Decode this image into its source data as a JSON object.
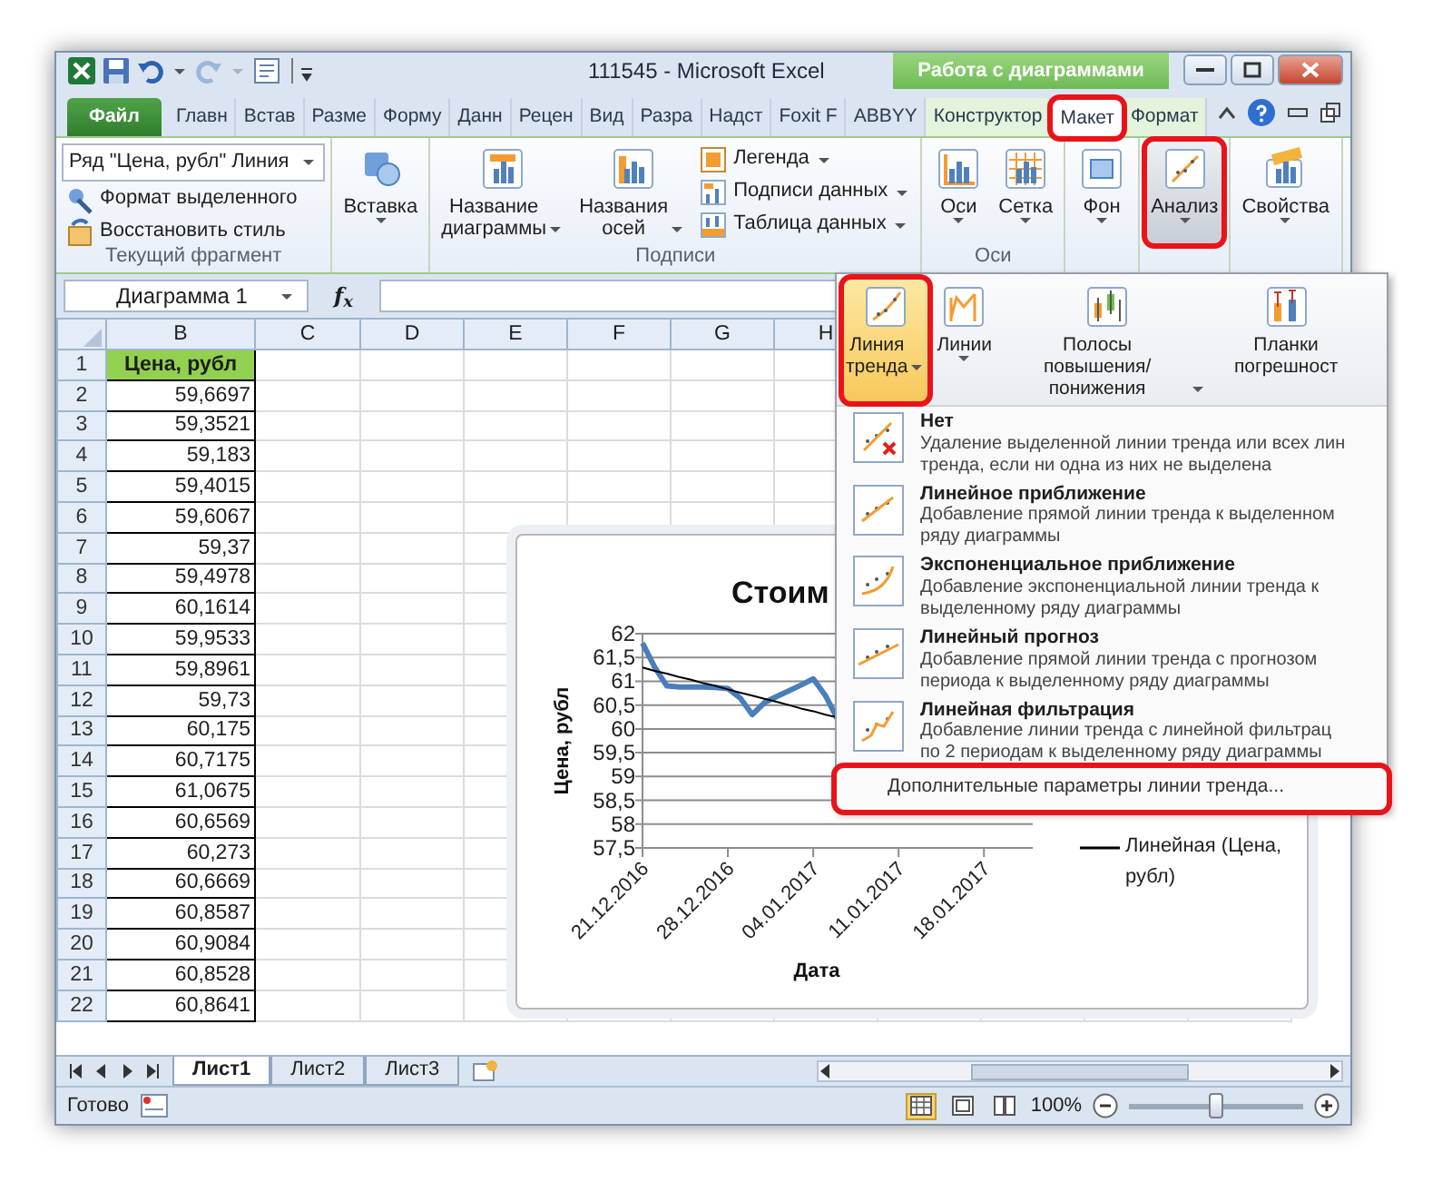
{
  "quick_access": [
    {
      "kind": "excel",
      "disabled": false
    },
    {
      "kind": "save",
      "disabled": false
    },
    {
      "kind": "undo",
      "disabled": false
    },
    {
      "kind": "redo",
      "disabled": true
    },
    {
      "kind": "form",
      "disabled": false
    },
    {
      "kind": "customize",
      "disabled": false
    }
  ],
  "window": {
    "title": "111545 - Microsoft Excel",
    "context_group": "Работа с диаграммами"
  },
  "ribbon_tabs": [
    {
      "label": "Файл",
      "kind": "file",
      "selected": false,
      "highlighted": false
    },
    {
      "label": "Главн",
      "kind": "normal",
      "selected": false,
      "highlighted": false
    },
    {
      "label": "Встав",
      "kind": "normal",
      "selected": false,
      "highlighted": false
    },
    {
      "label": "Разме",
      "kind": "normal",
      "selected": false,
      "highlighted": false
    },
    {
      "label": "Форму",
      "kind": "normal",
      "selected": false,
      "highlighted": false
    },
    {
      "label": "Данн",
      "kind": "normal",
      "selected": false,
      "highlighted": false
    },
    {
      "label": "Рецен",
      "kind": "normal",
      "selected": false,
      "highlighted": false
    },
    {
      "label": "Вид",
      "kind": "normal",
      "selected": false,
      "highlighted": false
    },
    {
      "label": "Разра",
      "kind": "normal",
      "selected": false,
      "highlighted": false
    },
    {
      "label": "Надст",
      "kind": "normal",
      "selected": false,
      "highlighted": false
    },
    {
      "label": "Foxit F",
      "kind": "normal",
      "selected": false,
      "highlighted": false
    },
    {
      "label": "ABBYY",
      "kind": "normal",
      "selected": false,
      "highlighted": false
    },
    {
      "label": "Конструктор",
      "kind": "context",
      "selected": false,
      "highlighted": false
    },
    {
      "label": "Макет",
      "kind": "context",
      "selected": true,
      "highlighted": true
    },
    {
      "label": "Формат",
      "kind": "context",
      "selected": false,
      "highlighted": false
    }
  ],
  "ribbon_groups": [
    {
      "kind": "selection",
      "label": "Текущий фрагмент",
      "dropdown": "Ряд \"Цена, рубл\" Линия",
      "commands": [
        "Формат выделенного",
        "Восстановить стиль"
      ]
    },
    {
      "kind": "buttons",
      "large": [
        {
          "label": "Вставка",
          "expanded": false,
          "highlighted": false
        }
      ]
    },
    {
      "kind": "buttons",
      "label": "Подписи",
      "large": [
        {
          "label": "Название диаграммы",
          "expanded": false,
          "highlighted": false
        },
        {
          "label": "Названия осей",
          "expanded": false,
          "highlighted": false
        }
      ],
      "small": [
        "Легенда",
        "Подписи данных",
        "Таблица данных"
      ]
    },
    {
      "kind": "buttons",
      "label": "Оси",
      "large": [
        {
          "label": "Оси",
          "expanded": false,
          "highlighted": false
        },
        {
          "label": "Сетка",
          "expanded": false,
          "highlighted": false
        }
      ]
    },
    {
      "kind": "buttons",
      "large": [
        {
          "label": "Фон",
          "expanded": false,
          "highlighted": false
        }
      ]
    },
    {
      "kind": "buttons",
      "large": [
        {
          "label": "Анализ",
          "expanded": true,
          "highlighted": true
        }
      ]
    },
    {
      "kind": "buttons",
      "large": [
        {
          "label": "Свойства",
          "expanded": false,
          "highlighted": false
        }
      ]
    }
  ],
  "formula_bar": {
    "name_box": "Диаграмма 1",
    "function_label": "f$_{x}$"
  },
  "sheet": {
    "columns": [
      "B",
      "C",
      "D",
      "E",
      "F",
      "G",
      "H"
    ],
    "rows": [
      {
        "number": "1",
        "value": "Цена, рубл",
        "kind": "header"
      },
      {
        "number": "2",
        "value": "59,6697",
        "kind": "number"
      },
      {
        "number": "3",
        "value": "59,3521",
        "kind": "number"
      },
      {
        "number": "4",
        "value": "59,183",
        "kind": "number"
      },
      {
        "number": "5",
        "value": "59,4015",
        "kind": "number"
      },
      {
        "number": "6",
        "value": "59,6067",
        "kind": "number"
      },
      {
        "number": "7",
        "value": "59,37",
        "kind": "number"
      },
      {
        "number": "8",
        "value": "59,4978",
        "kind": "number"
      },
      {
        "number": "9",
        "value": "60,1614",
        "kind": "number"
      },
      {
        "number": "10",
        "value": "59,9533",
        "kind": "number"
      },
      {
        "number": "11",
        "value": "59,8961",
        "kind": "number"
      },
      {
        "number": "12",
        "value": "59,73",
        "kind": "number"
      },
      {
        "number": "13",
        "value": "60,175",
        "kind": "number"
      },
      {
        "number": "14",
        "value": "60,7175",
        "kind": "number"
      },
      {
        "number": "15",
        "value": "61,0675",
        "kind": "number"
      },
      {
        "number": "16",
        "value": "60,6569",
        "kind": "number"
      },
      {
        "number": "17",
        "value": "60,273",
        "kind": "number"
      },
      {
        "number": "18",
        "value": "60,6669",
        "kind": "number"
      },
      {
        "number": "19",
        "value": "60,8587",
        "kind": "number"
      },
      {
        "number": "20",
        "value": "60,9084",
        "kind": "number"
      },
      {
        "number": "21",
        "value": "60,8528",
        "kind": "number"
      },
      {
        "number": "22",
        "value": "60,8641",
        "kind": "number"
      }
    ]
  },
  "chart": {
    "chart_data": {
      "type": "line",
      "title": "Стоим",
      "xlabel": "Дата",
      "ylabel": "Цена, рубл",
      "categories": [
        "21.12.2016",
        null,
        null,
        null,
        null,
        null,
        null,
        "28.12.2016",
        null,
        null,
        null,
        null,
        null,
        null,
        "04.01.2017",
        null,
        null,
        null,
        null,
        null,
        null,
        "11.01.2017",
        null,
        null,
        null,
        null,
        null,
        null,
        "18.01.2017",
        null,
        null,
        null
      ],
      "grid": true,
      "series": [
        {
          "color": "#4a7ebb",
          "values": [
            61.8,
            61.3,
            60.9,
            60.88,
            60.88,
            60.88,
            60.87,
            60.85,
            60.65,
            60.3,
            60.55,
            60.68,
            60.8,
            60.92,
            61.05,
            60.7,
            60.2,
            null,
            null,
            null,
            null,
            null,
            null,
            null,
            null,
            null,
            null,
            null,
            null,
            null,
            null,
            null
          ]
        },
        {
          "name": "Линейная (Цена, рубл)",
          "color": "#000000",
          "values": [
            61.29,
            61.22,
            61.16,
            61.09,
            61.03,
            60.96,
            60.9,
            60.83,
            60.76,
            60.7,
            60.63,
            60.57,
            60.5,
            60.43,
            60.37,
            60.3,
            60.24,
            null,
            null,
            null,
            null,
            null,
            null,
            null,
            null,
            null,
            null,
            null,
            null,
            null,
            null,
            null
          ]
        }
      ],
      "ylim": [
        57.5,
        62
      ],
      "yticks": [
        {
          "value": 57.5,
          "label": "57,5"
        },
        {
          "value": 58,
          "label": "58"
        },
        {
          "value": 58.5,
          "label": "58,5"
        },
        {
          "value": 59,
          "label": "59"
        },
        {
          "value": 59.5,
          "label": "59,5"
        },
        {
          "value": 60,
          "label": "60"
        },
        {
          "value": 60.5,
          "label": "60,5"
        },
        {
          "value": 61,
          "label": "61"
        },
        {
          "value": 61.5,
          "label": "61,5"
        },
        {
          "value": 62,
          "label": "62"
        }
      ]
    }
  },
  "trend_menu": {
    "gallery": [
      {
        "label": "Линия тренда",
        "selected": true,
        "highlighted": true
      },
      {
        "label": "Линии",
        "selected": false,
        "highlighted": false
      },
      {
        "label": "Полосы повышения/понижения",
        "selected": false,
        "highlighted": false
      },
      {
        "label": "Планки погрешност",
        "selected": false,
        "highlighted": false
      }
    ],
    "items": [
      {
        "kind": "none",
        "title": "Нет",
        "description_lines": [
          "Удаление выделенной линии тренда или всех лин",
          "тренда, если ни одна из них не выделена"
        ]
      },
      {
        "kind": "linear",
        "title": "Линейное приближение",
        "description_lines": [
          "Добавление прямой линии тренда к выделенном",
          "ряду диаграммы"
        ]
      },
      {
        "kind": "exponential",
        "title": "Экспоненциальное приближение",
        "description_lines": [
          "Добавление экспоненциальной линии тренда к",
          "выделенному ряду диаграммы"
        ]
      },
      {
        "kind": "forecast",
        "title": "Линейный прогноз",
        "description_lines": [
          "Добавление прямой линии тренда с прогнозом",
          "периода к выделенному ряду диаграммы"
        ]
      },
      {
        "kind": "moving_average",
        "title": "Линейная фильтрация",
        "description_lines": [
          "Добавление линии тренда с линейной фильтрац",
          "по 2 периодам к выделенному ряду диаграммы"
        ]
      }
    ],
    "more_options": {
      "label": "Дополнительные параметры линии тренда...",
      "highlighted": true
    }
  },
  "sheet_tabs": [
    {
      "label": "Лист1",
      "selected": true
    },
    {
      "label": "Лист2",
      "selected": false
    },
    {
      "label": "Лист3",
      "selected": false
    }
  ],
  "status_bar": {
    "status": "Готово",
    "views": [
      {
        "kind": "normal",
        "selected": true
      },
      {
        "kind": "page_layout",
        "selected": false
      },
      {
        "kind": "page_break",
        "selected": false
      }
    ],
    "zoom": "100%",
    "zoom_slider": {
      "level": 0.5
    }
  }
}
